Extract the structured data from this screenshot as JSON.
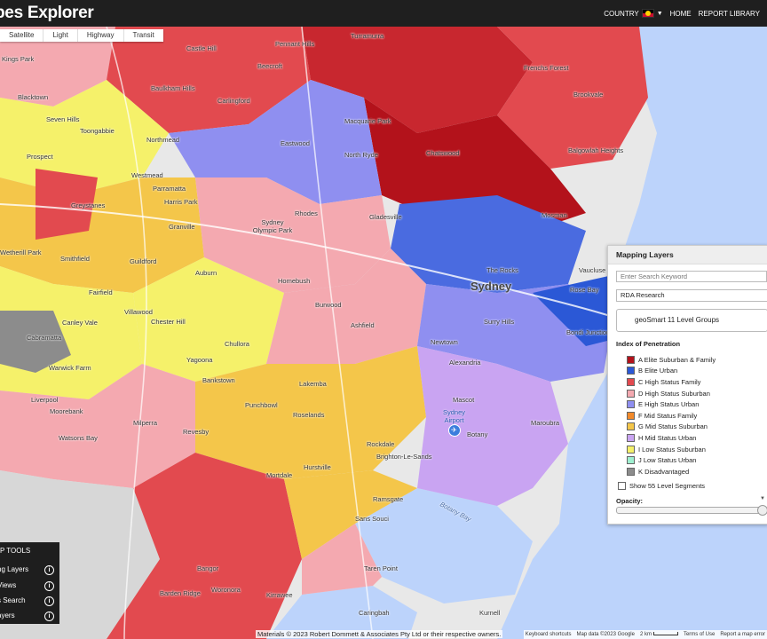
{
  "app": {
    "brand": "bes Explorer"
  },
  "nav": {
    "country_label": "COUNTRY",
    "home_label": "HOME",
    "report_library_label": "REPORT LIBRARY"
  },
  "map_types": [
    "Satellite",
    "Light",
    "Highway",
    "Transit"
  ],
  "place_labels": {
    "kings_park": "Kings Park",
    "baulkham_hills": "Baulkham Hills",
    "castle_hill": "Castle Hill",
    "pennant_hills": "Pennant Hills",
    "turramurra": "Turramurra",
    "frenchs_forest": "Frenchs Forest",
    "beecroft": "Beecroft",
    "blacktown": "Blacktown",
    "carlingford": "Carlingford",
    "seven_hills": "Seven Hills",
    "toongabbie": "Toongabbie",
    "northmead": "Northmead",
    "macquarie_park": "Macquarie Park",
    "brookvale": "Brookvale",
    "eastwood": "Eastwood",
    "prospect": "Prospect",
    "north_ryde": "North Ryde",
    "chatswood": "Chatswood",
    "balgowlah": "Balgowlah Heights",
    "westmead": "Westmead",
    "parramatta": "Parramatta",
    "harris_park": "Harris Park",
    "greystanes": "Greystanes",
    "granville": "Granville",
    "rhodes": "Rhodes",
    "gladesville": "Gladesville",
    "mosman": "Mosman",
    "sydney_olympic_park": "Sydney Olympic Park",
    "wetherill_park": "Wetherill Park",
    "smithfield": "Smithfield",
    "guildford": "Guildford",
    "auburn": "Auburn",
    "vaucluse": "Vaucluse",
    "the_rocks": "The Rocks",
    "sydney": "Sydney",
    "rose_bay": "Rose Bay",
    "homebush": "Homebush",
    "fairfield": "Fairfield",
    "burwood": "Burwood",
    "canley_vale": "Canley Vale",
    "villawood": "Villawood",
    "chester_hill": "Chester Hill",
    "ashfield": "Ashfield",
    "surry_hills": "Surry Hills",
    "bondi_junction": "Bondi Junction",
    "cabramatta": "Cabramatta",
    "chullora": "Chullora",
    "newtown": "Newtown",
    "warwick_farm": "Warwick Farm",
    "yagoona": "Yagoona",
    "alexandria": "Alexandria",
    "bankstown": "Bankstown",
    "lakemba": "Lakemba",
    "mascot": "Mascot",
    "liverpool": "Liverpool",
    "moorebank": "Moorebank",
    "punchbowl": "Punchbowl",
    "maroubra": "Maroubra",
    "roselands": "Roselands",
    "watsons_bay": "Watsons Bay",
    "milperra": "Milperra",
    "revesby": "Revesby",
    "botany": "Botany",
    "rockdale": "Rockdale",
    "brighton": "Brighton-Le-Sands",
    "hurstville": "Hurstville",
    "mortdale": "Mortdale",
    "ramsgate": "Ramsgate",
    "sans_souci": "Sans Souci",
    "botany_bay": "Botany Bay",
    "taren_point": "Taren Point",
    "bangor": "Bangor",
    "barden_ridge": "Barden Ridge",
    "woronora": "Woronora",
    "kirrawee": "Kirrawee",
    "caringbah": "Caringbah",
    "kurnell": "Kurnell"
  },
  "airport": {
    "label_line1": "Sydney",
    "label_line2": "Airport"
  },
  "mapping_layers": {
    "title": "Mapping Layers",
    "search_placeholder": "Enter Search Keyword",
    "source_value": "RDA Research",
    "level_button": "geoSmart 11 Level Groups",
    "index_label": "Index of Penetration",
    "legend": [
      {
        "label": "A Elite Suburban & Family",
        "color": "#b3121b"
      },
      {
        "label": "B Elite Urban",
        "color": "#2b58d6"
      },
      {
        "label": "C High Status Family",
        "color": "#e24a4f"
      },
      {
        "label": "D High Status Suburban",
        "color": "#f4a9b0"
      },
      {
        "label": "E High Status Urban",
        "color": "#8f8ff0"
      },
      {
        "label": "F Mid Status Family",
        "color": "#f28a2b"
      },
      {
        "label": "G Mid Status Suburban",
        "color": "#f4c64a"
      },
      {
        "label": "H Mid Status Urban",
        "color": "#c9a4f2"
      },
      {
        "label": "I Low Status Suburban",
        "color": "#f5f16a"
      },
      {
        "label": "J Low Status Urban",
        "color": "#9ff0d0"
      },
      {
        "label": "K Disadvantaged",
        "color": "#8c8c8c"
      }
    ],
    "show_segments_label": "Show 55 Level Segments",
    "opacity_label": "Opacity:",
    "opacity_value": 1.0
  },
  "map_tools": {
    "title": "P TOOLS",
    "items": [
      "ng Layers",
      "Views",
      "s Search",
      "ayers"
    ]
  },
  "attribution": "Materials © 2023 Robert Dommett & Associates Pty Ltd or their respective owners.",
  "google_footer": {
    "shortcuts": "Keyboard shortcuts",
    "map_data": "Map data ©2023 Google",
    "scale": "2 km",
    "terms": "Terms of Use",
    "report": "Report a map error"
  }
}
